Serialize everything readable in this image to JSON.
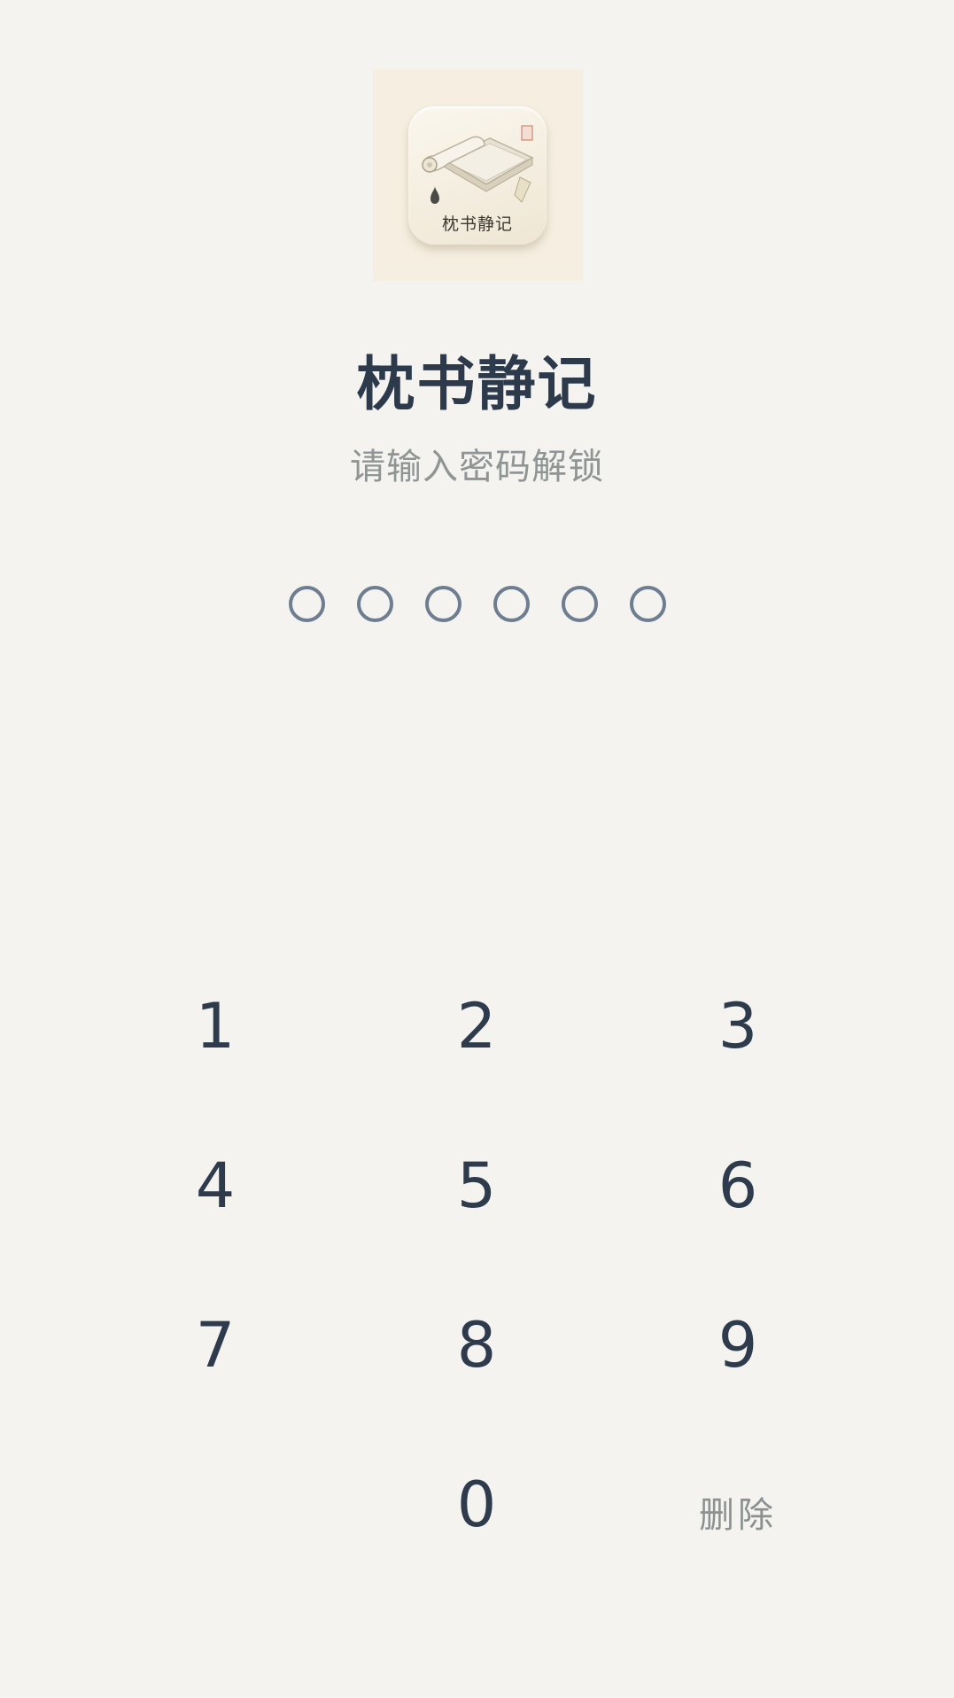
{
  "app": {
    "icon_name": "book-scroll-app-icon",
    "icon_caption": "枕书静记",
    "title": "枕书静记",
    "subtitle": "请输入密码解锁"
  },
  "pin": {
    "length": 6,
    "entered": 0
  },
  "keypad": {
    "k1": "1",
    "k2": "2",
    "k3": "3",
    "k4": "4",
    "k5": "5",
    "k6": "6",
    "k7": "7",
    "k8": "8",
    "k9": "9",
    "k0": "0",
    "delete_label": "删除"
  },
  "colors": {
    "background": "#f4f3f0",
    "title": "#2c3a4b",
    "subtitle": "#8e9594",
    "pin_dot_border": "#6e7d8f",
    "key_digit": "#2d3b4c",
    "key_delete": "#8a9190"
  }
}
